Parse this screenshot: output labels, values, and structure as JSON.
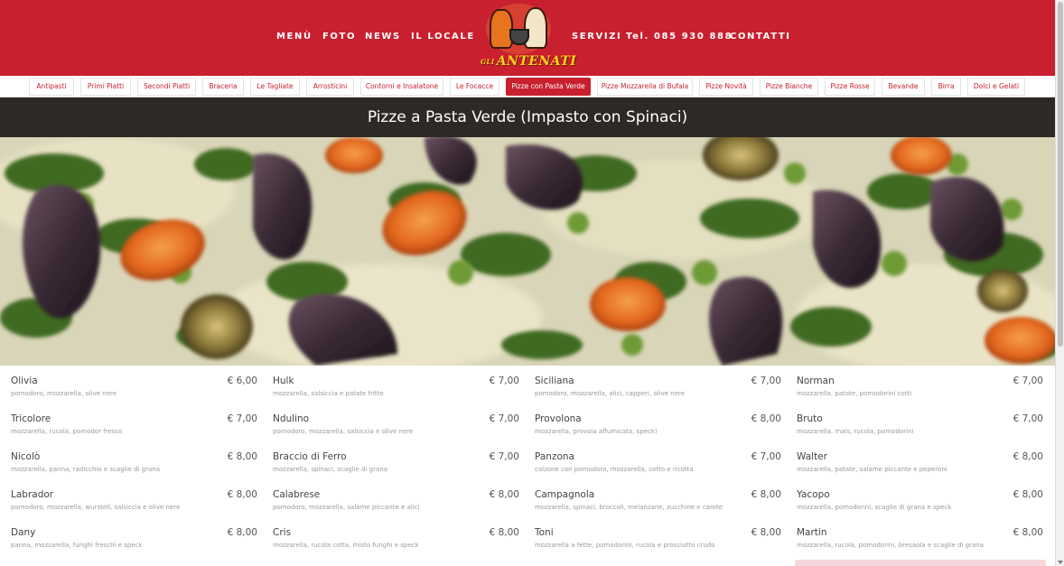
{
  "header": {
    "nav_left": [
      "MENÙ",
      "FOTO",
      "NEWS",
      "IL LOCALE"
    ],
    "nav_right": [
      "SERVIZI",
      "Tel. 085 930 888",
      "CONTATTI"
    ],
    "logo": {
      "prefix": "GLI",
      "name": "ANTENATI"
    },
    "colors": {
      "brand_red": "#c8202f",
      "logo_yellow": "#ffd21a"
    }
  },
  "tabs": [
    "Antipasti",
    "Primi Piatti",
    "Secondi Piatti",
    "Braceria",
    "Le Tagliate",
    "Arrosticini",
    "Contorni e Insalatone",
    "Le Focacce",
    "Pizze con Pasta Verde",
    "Pizze Mozzarella di Bufala",
    "Pizze Novità",
    "Pizze Bianche",
    "Pizze Rosse",
    "Bevande",
    "Birra",
    "Dolci e Gelati"
  ],
  "active_tab": "Pizze con Pasta Verde",
  "section_title": "Pizze a Pasta Verde (Impasto con Spinaci)",
  "menu": {
    "columns": [
      [
        {
          "name": "Olivia",
          "price": "€ 6,00",
          "desc": "pomodoro, mozzarella, olive nere"
        },
        {
          "name": "Tricolore",
          "price": "€ 7,00",
          "desc": "mozzarella, rucola, pomodor fresco"
        },
        {
          "name": "Nicolò",
          "price": "€ 8,00",
          "desc": "mozzarella, panna, radicchio e scaglie di grana"
        },
        {
          "name": "Labrador",
          "price": "€ 8,00",
          "desc": "pomodoro, mozzarella, wurstell, salsiccia e olive nere"
        },
        {
          "name": "Dany",
          "price": "€ 8,00",
          "desc": "panna, mozzarella, funghi freschi e speck"
        }
      ],
      [
        {
          "name": "Hulk",
          "price": "€ 7,00",
          "desc": "mozzarella, salsiccia e patate fritte"
        },
        {
          "name": "Ndulino",
          "price": "€ 7,00",
          "desc": "pomodoro, mozzarella, salsiccia e olive nere"
        },
        {
          "name": "Braccio di Ferro",
          "price": "€ 7,00",
          "desc": "mozzarella, spinaci, scaglie di grana"
        },
        {
          "name": "Calabrese",
          "price": "€ 8,00",
          "desc": "pomodoro, mozzarella, salame piccante e alici"
        },
        {
          "name": "Cris",
          "price": "€ 8,00",
          "desc": "mozzarella, rucola cotta, misto funghi e speck"
        }
      ],
      [
        {
          "name": "Siciliana",
          "price": "€ 7,00",
          "desc": "pomodoro, mozzarella, alici, capperi, olive nere"
        },
        {
          "name": "Provolona",
          "price": "€ 8,00",
          "desc": "mozzarella, provola affumicata, speck)"
        },
        {
          "name": "Panzona",
          "price": "€ 7,00",
          "desc": "calzone con pomodoro, mozzarella, cotto e ricotta"
        },
        {
          "name": "Campagnola",
          "price": "€ 8,00",
          "desc": "mozzarella, spinaci, broccoli, melanzane, zucchine e carote"
        },
        {
          "name": "Toni",
          "price": "€ 8,00",
          "desc": "mozzarella a fette, pomodorini, rucola e prosciutto crudo"
        }
      ],
      [
        {
          "name": "Norman",
          "price": "€ 7,00",
          "desc": "mozzarella, patate, pomodorini cotti"
        },
        {
          "name": "Bruto",
          "price": "€ 7,00",
          "desc": "mozzarella, mais, rucola, pomodorini"
        },
        {
          "name": "Walter",
          "price": "€ 8,00",
          "desc": "mozzarella, patate, salame piccante e peperoni"
        },
        {
          "name": "Yacopo",
          "price": "€ 8,00",
          "desc": "mozzarella, pomodorini, scaglie di grana e speck"
        },
        {
          "name": "Martin",
          "price": "€ 8,00",
          "desc": "mozzarella, rucola, pomodorini, bresaola e scaglie di grana"
        }
      ]
    ]
  }
}
